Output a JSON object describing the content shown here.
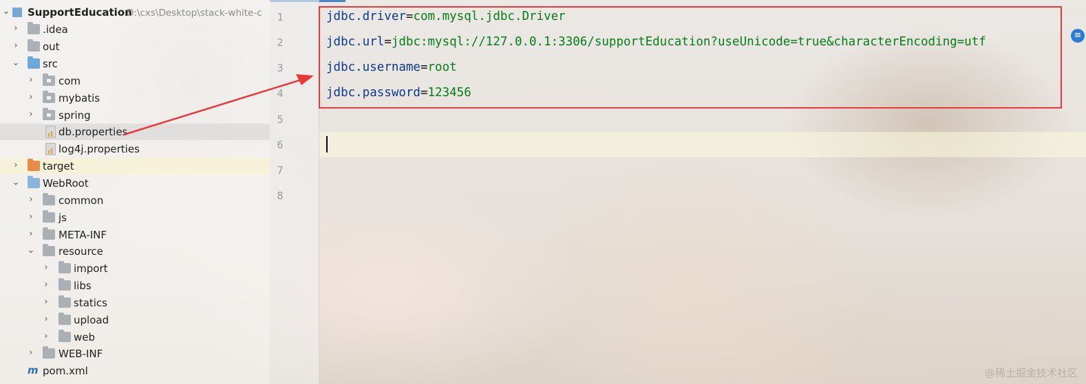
{
  "project": {
    "name": "SupportEducation",
    "path": "D:\\cxs\\Desktop\\stack-white-c"
  },
  "tree": [
    {
      "label": ".idea",
      "chev": "›"
    },
    {
      "label": "out",
      "chev": "›"
    },
    {
      "label": "src",
      "chev": "⌄"
    },
    {
      "label": "com",
      "chev": "›"
    },
    {
      "label": "mybatis",
      "chev": "›"
    },
    {
      "label": "spring",
      "chev": "›"
    },
    {
      "label": "db.properties",
      "chev": ""
    },
    {
      "label": "log4j.properties",
      "chev": ""
    },
    {
      "label": "target",
      "chev": "›"
    },
    {
      "label": "WebRoot",
      "chev": "⌄"
    },
    {
      "label": "common",
      "chev": "›"
    },
    {
      "label": "js",
      "chev": "›"
    },
    {
      "label": "META-INF",
      "chev": "›"
    },
    {
      "label": "resource",
      "chev": "⌄"
    },
    {
      "label": "import",
      "chev": "›"
    },
    {
      "label": "libs",
      "chev": "›"
    },
    {
      "label": "statics",
      "chev": "›"
    },
    {
      "label": "upload",
      "chev": "›"
    },
    {
      "label": "web",
      "chev": "›"
    },
    {
      "label": "WEB-INF",
      "chev": "›"
    },
    {
      "label": "pom.xml",
      "chev": ""
    }
  ],
  "root_chevron": "⌄",
  "maven_glyph": "m",
  "editor": {
    "line_numbers": [
      "1",
      "2",
      "3",
      "4",
      "5",
      "6",
      "7",
      "8"
    ],
    "lines": [
      {
        "key": "jdbc.driver",
        "sep": "=",
        "value": "com.mysql.jdbc.Driver"
      },
      {
        "key": "jdbc.url",
        "sep": "=",
        "value": "jdbc:mysql://127.0.0.1:3306/supportEducation?useUnicode=true&characterEncoding=utf"
      },
      {
        "key": "jdbc.username",
        "sep": "=",
        "value": "root"
      },
      {
        "key": "jdbc.password",
        "sep": "=",
        "value": "123456"
      }
    ],
    "edge_icon_glyph": "≡"
  },
  "watermark": "@稀土掘金技术社区",
  "colors": {
    "highlight_box": "#e8383a",
    "arrow": "#e8383a",
    "property_key": "#0d3a8a",
    "property_value": "#067d17"
  }
}
